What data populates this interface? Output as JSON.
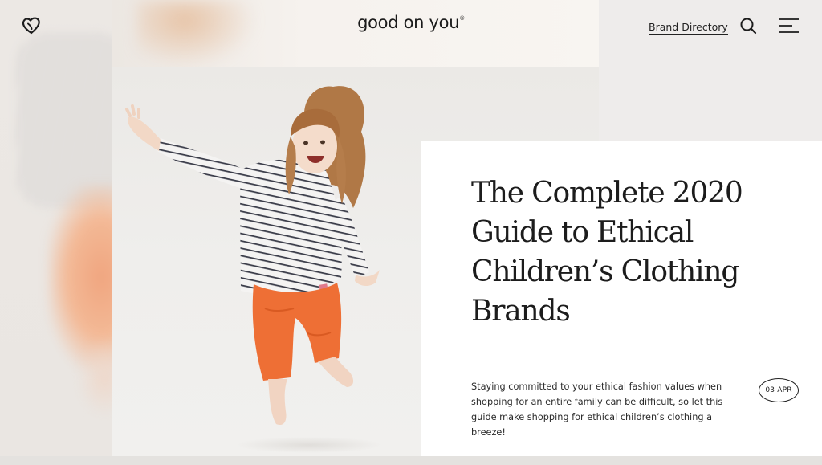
{
  "header": {
    "wordmark": "good on you",
    "wordmark_mark": "®",
    "brand_directory_label": "Brand Directory",
    "icons": {
      "logo": "heart-logo-icon",
      "search": "search-icon",
      "menu": "hamburger-menu-icon"
    }
  },
  "article": {
    "title": "The Complete 2020 Guide to Ethical Children’s Clothing Brands",
    "excerpt": "Staying committed to your ethical fashion values when shopping for an entire family can be difficult, so let this guide make shopping for ethical children’s clothing a breeze!",
    "date": "03 APR"
  },
  "colors": {
    "background": "#efedea",
    "card": "#ffffff",
    "text": "#1c1c1c",
    "pants_orange": "#ee6f35"
  }
}
